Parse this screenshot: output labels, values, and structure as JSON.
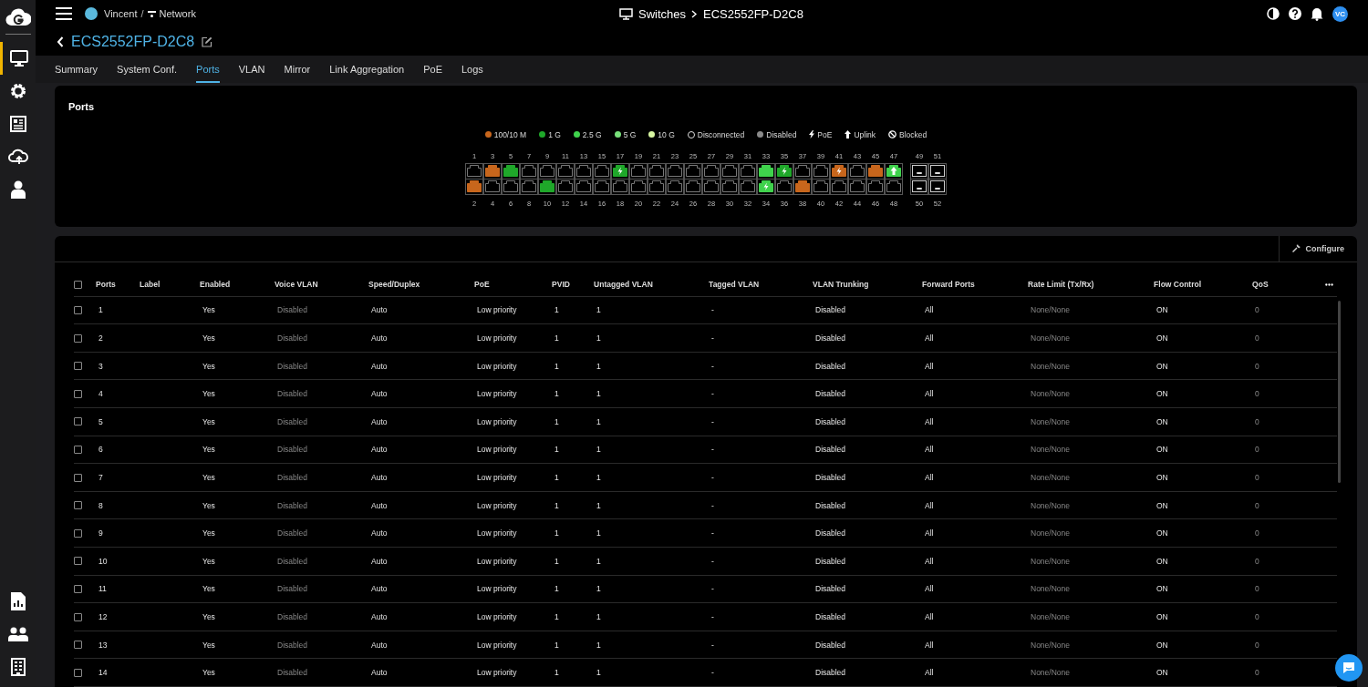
{
  "topbar": {
    "org": "Vincent",
    "separator": "/",
    "network": "Network",
    "breadcrumb": [
      "Switches",
      "ECS2552FP-D2C8"
    ],
    "avatar": "VC"
  },
  "sidebar": {
    "items": [
      {
        "selected": true
      },
      {
        "selected": false
      },
      {
        "selected": false
      },
      {
        "selected": false
      },
      {
        "selected": false
      }
    ],
    "bottom_items": [
      {
        "selected": false
      },
      {
        "selected": false
      },
      {
        "selected": false
      }
    ]
  },
  "device_title": "ECS2552FP-D2C8",
  "tabs": [
    {
      "label": "Summary",
      "selected": false
    },
    {
      "label": "System Conf.",
      "selected": false
    },
    {
      "label": "Ports",
      "selected": true
    },
    {
      "label": "VLAN",
      "selected": false
    },
    {
      "label": "Mirror",
      "selected": false
    },
    {
      "label": "Link Aggregation",
      "selected": false
    },
    {
      "label": "PoE",
      "selected": false
    },
    {
      "label": "Logs",
      "selected": false
    }
  ],
  "ports_panel": {
    "title": "Ports",
    "legend": [
      {
        "kind": "dot",
        "label": "100/10 M",
        "color": "#c8661c"
      },
      {
        "kind": "dot",
        "label": "1 G",
        "color": "#1fa82a"
      },
      {
        "kind": "dot",
        "label": "2.5 G",
        "color": "#3fd24c"
      },
      {
        "kind": "dot",
        "label": "5 G",
        "color": "#78e07a"
      },
      {
        "kind": "dot",
        "label": "10 G",
        "color": "#d8f7a2"
      },
      {
        "kind": "ring",
        "label": "Disconnected"
      },
      {
        "kind": "dot",
        "label": "Disabled",
        "color": "#8a8a8a"
      },
      {
        "kind": "poe",
        "label": "PoE"
      },
      {
        "kind": "uplink",
        "label": "Uplink"
      },
      {
        "kind": "blocked",
        "label": "Blocked"
      }
    ],
    "ports": [
      {
        "number": "1",
        "poe": false,
        "uplink": false
      },
      {
        "number": "2",
        "color": "#c8661c",
        "poe": false,
        "uplink": false
      },
      {
        "number": "3",
        "color": "#c8661c",
        "poe": false,
        "uplink": false
      },
      {
        "number": "4",
        "poe": false,
        "uplink": false
      },
      {
        "number": "5",
        "color": "#1fa82a",
        "poe": false,
        "uplink": false
      },
      {
        "number": "6",
        "poe": false,
        "uplink": false
      },
      {
        "number": "7",
        "poe": false,
        "uplink": false
      },
      {
        "number": "8",
        "poe": false,
        "uplink": false
      },
      {
        "number": "9",
        "poe": false,
        "uplink": false
      },
      {
        "number": "10",
        "color": "#1fa82a",
        "poe": false,
        "uplink": false
      },
      {
        "number": "11",
        "poe": false,
        "uplink": false
      },
      {
        "number": "12",
        "poe": false,
        "uplink": false
      },
      {
        "number": "13",
        "poe": false,
        "uplink": false
      },
      {
        "number": "14",
        "poe": false,
        "uplink": false
      },
      {
        "number": "15",
        "poe": false,
        "uplink": false
      },
      {
        "number": "16",
        "poe": false,
        "uplink": false
      },
      {
        "number": "17",
        "color": "#1fa82a",
        "poe": true,
        "uplink": false
      },
      {
        "number": "18",
        "poe": false,
        "uplink": false
      },
      {
        "number": "19",
        "poe": false,
        "uplink": false
      },
      {
        "number": "20",
        "poe": false,
        "uplink": false
      },
      {
        "number": "21",
        "poe": false,
        "uplink": false
      },
      {
        "number": "22",
        "poe": false,
        "uplink": false
      },
      {
        "number": "23",
        "poe": false,
        "uplink": false
      },
      {
        "number": "24",
        "poe": false,
        "uplink": false
      },
      {
        "number": "25",
        "poe": false,
        "uplink": false
      },
      {
        "number": "26",
        "poe": false,
        "uplink": false
      },
      {
        "number": "27",
        "poe": false,
        "uplink": false
      },
      {
        "number": "28",
        "poe": false,
        "uplink": false
      },
      {
        "number": "29",
        "poe": false,
        "uplink": false
      },
      {
        "number": "30",
        "poe": false,
        "uplink": false
      },
      {
        "number": "31",
        "poe": false,
        "uplink": false
      },
      {
        "number": "32",
        "poe": false,
        "uplink": false
      },
      {
        "number": "33",
        "color": "#3fd24c",
        "poe": false,
        "uplink": false
      },
      {
        "number": "34",
        "color": "#3fd24c",
        "poe": true,
        "uplink": false
      },
      {
        "number": "35",
        "color": "#1fa82a",
        "poe": true,
        "uplink": false
      },
      {
        "number": "36",
        "poe": false,
        "uplink": false
      },
      {
        "number": "37",
        "poe": false,
        "uplink": false
      },
      {
        "number": "38",
        "color": "#c8661c",
        "poe": false,
        "uplink": false
      },
      {
        "number": "39",
        "poe": false,
        "uplink": false
      },
      {
        "number": "40",
        "poe": false,
        "uplink": false
      },
      {
        "number": "41",
        "color": "#c8661c",
        "poe": true,
        "uplink": false
      },
      {
        "number": "42",
        "poe": false,
        "uplink": false
      },
      {
        "number": "43",
        "poe": false,
        "uplink": false
      },
      {
        "number": "44",
        "poe": false,
        "uplink": false
      },
      {
        "number": "45",
        "color": "#c8661c",
        "poe": false,
        "uplink": false
      },
      {
        "number": "46",
        "poe": false,
        "uplink": false
      },
      {
        "number": "47",
        "color": "#3fd24c",
        "poe": false,
        "uplink": true
      },
      {
        "number": "48",
        "poe": false,
        "uplink": false
      }
    ],
    "sfp_ports": [
      {
        "number": "49"
      },
      {
        "number": "50"
      },
      {
        "number": "51"
      },
      {
        "number": "52"
      }
    ]
  },
  "table": {
    "configure_button": "Configure",
    "header_checked": false,
    "columns": [
      {
        "label": "Ports",
        "dimmed": false
      },
      {
        "label": "Label"
      },
      {
        "label": "Enabled",
        "dimmed": false
      },
      {
        "label": "Voice VLAN",
        "dimmed": true
      },
      {
        "label": "Speed/Duplex",
        "dimmed": false
      },
      {
        "label": "PoE",
        "dimmed": false
      },
      {
        "label": "PVID",
        "dimmed": false
      },
      {
        "label": "Untagged VLAN",
        "dimmed": false
      },
      {
        "label": "Tagged VLAN",
        "dimmed": false
      },
      {
        "label": "VLAN Trunking",
        "dimmed": false
      },
      {
        "label": "Forward Ports",
        "dimmed": false
      },
      {
        "label": "Rate Limit (Tx/Rx)",
        "dimmed": true
      },
      {
        "label": "Flow Control",
        "dimmed": false
      },
      {
        "label": "QoS",
        "dimmed": true
      }
    ],
    "rows": [
      {
        "checked": false,
        "cells": [
          "1",
          null,
          "Yes",
          "Disabled",
          "Auto",
          "Low priority",
          "1",
          "1",
          "-",
          "Disabled",
          "All",
          "None/None",
          "ON",
          "0"
        ]
      },
      {
        "checked": false,
        "cells": [
          "2",
          null,
          "Yes",
          "Disabled",
          "Auto",
          "Low priority",
          "1",
          "1",
          "-",
          "Disabled",
          "All",
          "None/None",
          "ON",
          "0"
        ]
      },
      {
        "checked": false,
        "cells": [
          "3",
          null,
          "Yes",
          "Disabled",
          "Auto",
          "Low priority",
          "1",
          "1",
          "-",
          "Disabled",
          "All",
          "None/None",
          "ON",
          "0"
        ]
      },
      {
        "checked": false,
        "cells": [
          "4",
          null,
          "Yes",
          "Disabled",
          "Auto",
          "Low priority",
          "1",
          "1",
          "-",
          "Disabled",
          "All",
          "None/None",
          "ON",
          "0"
        ]
      },
      {
        "checked": false,
        "cells": [
          "5",
          null,
          "Yes",
          "Disabled",
          "Auto",
          "Low priority",
          "1",
          "1",
          "-",
          "Disabled",
          "All",
          "None/None",
          "ON",
          "0"
        ]
      },
      {
        "checked": false,
        "cells": [
          "6",
          null,
          "Yes",
          "Disabled",
          "Auto",
          "Low priority",
          "1",
          "1",
          "-",
          "Disabled",
          "All",
          "None/None",
          "ON",
          "0"
        ]
      },
      {
        "checked": false,
        "cells": [
          "7",
          null,
          "Yes",
          "Disabled",
          "Auto",
          "Low priority",
          "1",
          "1",
          "-",
          "Disabled",
          "All",
          "None/None",
          "ON",
          "0"
        ]
      },
      {
        "checked": false,
        "cells": [
          "8",
          null,
          "Yes",
          "Disabled",
          "Auto",
          "Low priority",
          "1",
          "1",
          "-",
          "Disabled",
          "All",
          "None/None",
          "ON",
          "0"
        ]
      },
      {
        "checked": false,
        "cells": [
          "9",
          null,
          "Yes",
          "Disabled",
          "Auto",
          "Low priority",
          "1",
          "1",
          "-",
          "Disabled",
          "All",
          "None/None",
          "ON",
          "0"
        ]
      },
      {
        "checked": false,
        "cells": [
          "10",
          null,
          "Yes",
          "Disabled",
          "Auto",
          "Low priority",
          "1",
          "1",
          "-",
          "Disabled",
          "All",
          "None/None",
          "ON",
          "0"
        ]
      },
      {
        "checked": false,
        "cells": [
          "11",
          null,
          "Yes",
          "Disabled",
          "Auto",
          "Low priority",
          "1",
          "1",
          "-",
          "Disabled",
          "All",
          "None/None",
          "ON",
          "0"
        ]
      },
      {
        "checked": false,
        "cells": [
          "12",
          null,
          "Yes",
          "Disabled",
          "Auto",
          "Low priority",
          "1",
          "1",
          "-",
          "Disabled",
          "All",
          "None/None",
          "ON",
          "0"
        ]
      },
      {
        "checked": false,
        "cells": [
          "13",
          null,
          "Yes",
          "Disabled",
          "Auto",
          "Low priority",
          "1",
          "1",
          "-",
          "Disabled",
          "All",
          "None/None",
          "ON",
          "0"
        ]
      },
      {
        "checked": false,
        "cells": [
          "14",
          null,
          "Yes",
          "Disabled",
          "Auto",
          "Low priority",
          "1",
          "1",
          "-",
          "Disabled",
          "All",
          "None/None",
          "ON",
          "0"
        ]
      }
    ]
  }
}
